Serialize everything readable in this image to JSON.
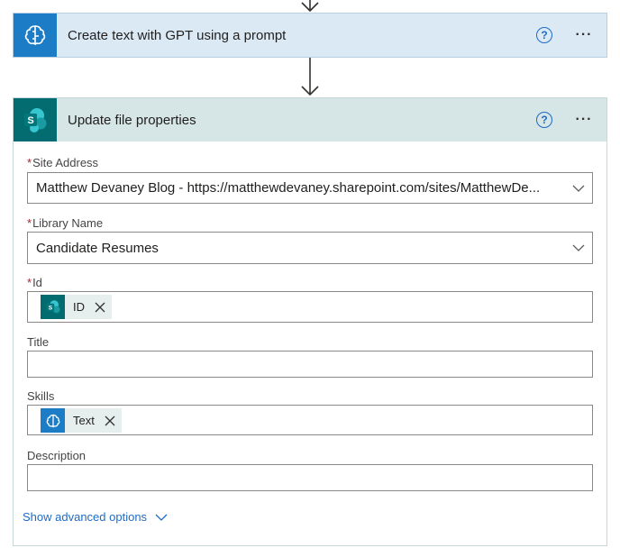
{
  "gpt_card": {
    "title": "Create text with GPT using a prompt",
    "icon": "ai-brain-icon",
    "help": "?",
    "more": "···"
  },
  "update_card": {
    "title": "Update file properties",
    "icon": "sharepoint-icon",
    "help": "?",
    "more": "···",
    "fields": {
      "site_address": {
        "required": "*",
        "label": "Site Address",
        "value": "Matthew Devaney Blog - https://matthewdevaney.sharepoint.com/sites/MatthewDe..."
      },
      "library_name": {
        "required": "*",
        "label": "Library Name",
        "value": "Candidate Resumes"
      },
      "id": {
        "required": "*",
        "label": "Id",
        "token": "ID"
      },
      "title": {
        "label": "Title",
        "value": ""
      },
      "skills": {
        "label": "Skills",
        "token": "Text"
      },
      "description": {
        "label": "Description",
        "value": ""
      }
    },
    "advanced_label": "Show advanced options"
  },
  "colors": {
    "gpt_header": "#dbe9f5",
    "sp_header": "#d6e5e5",
    "sp_brand": "#036c70",
    "gpt_brand": "#1c7dc6",
    "link": "#1f6bc6",
    "required": "#a4262c"
  }
}
